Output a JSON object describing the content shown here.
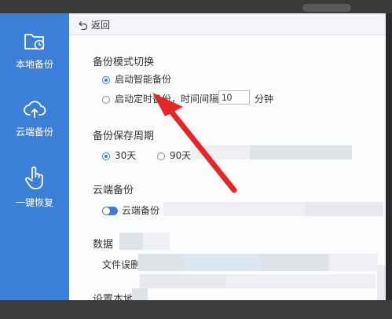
{
  "colors": {
    "sidebar_bg": "#3b7fd9",
    "accent": "#3b7fd9",
    "arrow": "#e8262a",
    "frame": "#2b2b2b"
  },
  "sidebar": {
    "items": [
      {
        "label": "本地备份",
        "icon": "folder-clock-icon"
      },
      {
        "label": "云端备份",
        "icon": "cloud-upload-icon"
      },
      {
        "label": "一键恢复",
        "icon": "hand-pointer-icon"
      }
    ]
  },
  "toolbar": {
    "back_label": "返回",
    "back_icon": "undo-icon"
  },
  "backup_mode": {
    "title": "备份模式切换",
    "option_smart": "启动智能备份",
    "option_timed_prefix": "启动定时",
    "option_timed_suffix": "备份，时间间隔",
    "interval_value": "10",
    "interval_unit": "分钟",
    "selected": "smart"
  },
  "retention": {
    "title": "备份保存周期",
    "option_30": "30天",
    "option_90": "90天",
    "selected": "30"
  },
  "cloud": {
    "title": "云端备份",
    "toggle_label": "云端备份",
    "enabled": true
  },
  "data_section": {
    "title_visible": "数据",
    "item_visible": "文件误删不"
  },
  "local_section": {
    "title_visible": "设置本地"
  },
  "annotation": {
    "icon": "red-arrow-icon"
  }
}
